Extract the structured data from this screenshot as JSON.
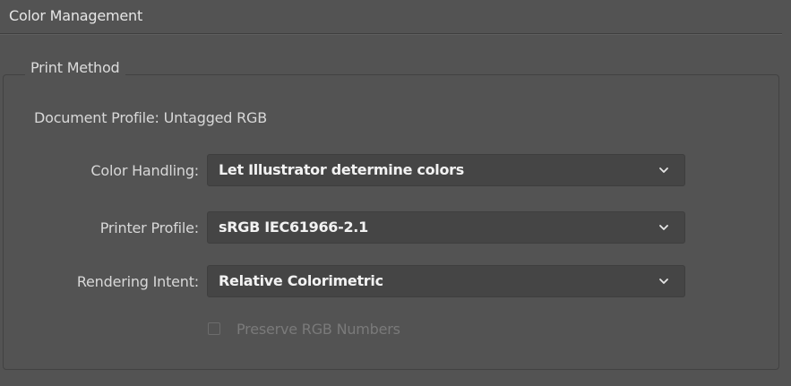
{
  "section": {
    "title": "Color Management"
  },
  "print_method": {
    "group_title": "Print Method",
    "document_profile": "Document Profile: Untagged RGB",
    "color_handling": {
      "label": "Color Handling:",
      "value": "Let Illustrator determine colors"
    },
    "printer_profile": {
      "label": "Printer Profile:",
      "value": "sRGB IEC61966-2.1"
    },
    "rendering_intent": {
      "label": "Rendering Intent:",
      "value": "Relative Colorimetric"
    },
    "preserve_rgb": {
      "label": "Preserve RGB Numbers",
      "checked": false,
      "disabled": true
    }
  },
  "icons": {
    "dropdown": "chevron-down-icon"
  },
  "colors": {
    "background": "#535353",
    "field": "#454545",
    "text": "#d8d8d8",
    "disabled_text": "#7a7a7a"
  }
}
